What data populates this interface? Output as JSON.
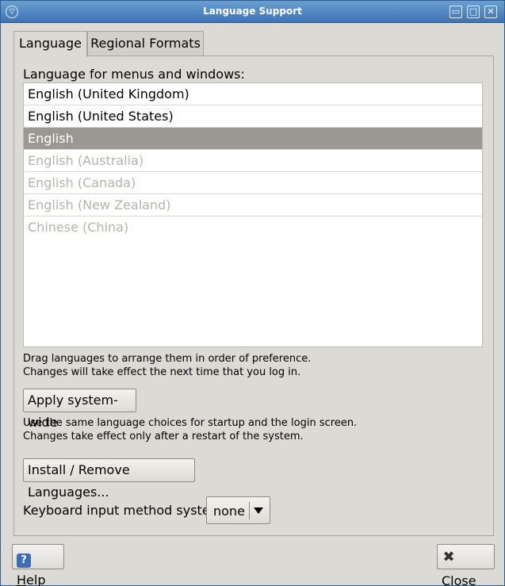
{
  "window": {
    "title": "Language Support",
    "menu_glyph": "▽",
    "minimize_glyph": "▭",
    "maximize_glyph": "□",
    "close_glyph": "✕"
  },
  "tabs": [
    {
      "label": "Language",
      "active": true
    },
    {
      "label": "Regional Formats",
      "active": false
    }
  ],
  "language": {
    "list_label": "Language for menus and windows:",
    "items": [
      {
        "label": "English (United Kingdom)",
        "state": "normal"
      },
      {
        "label": "English (United States)",
        "state": "normal"
      },
      {
        "label": "English",
        "state": "selected"
      },
      {
        "label": "English (Australia)",
        "state": "dim"
      },
      {
        "label": "English (Canada)",
        "state": "dim"
      },
      {
        "label": "English (New Zealand)",
        "state": "dim"
      },
      {
        "label": "Chinese (China)",
        "state": "dim"
      }
    ],
    "hint_line1": "Drag languages to arrange them in order of preference.",
    "hint_line2": "Changes will take effect the next time that you log in.",
    "apply_button": "Apply system-wide",
    "apply_hint_line1": "Use the same language choices for startup and the login screen.",
    "apply_hint_line2": "Changes take effect only after a restart of the system.",
    "install_button": "Install / Remove Languages...",
    "keyboard_label": "Keyboard input method system:",
    "keyboard_value": "none"
  },
  "footer": {
    "help_icon": "?",
    "help_label_first": "H",
    "help_label_rest": "elp",
    "close_icon": "✖",
    "close_label_first": "C",
    "close_label_rest": "lose"
  },
  "colors": {
    "titlebar": "#3c74b3",
    "selection": "#9b9893",
    "background": "#dcdad5"
  }
}
